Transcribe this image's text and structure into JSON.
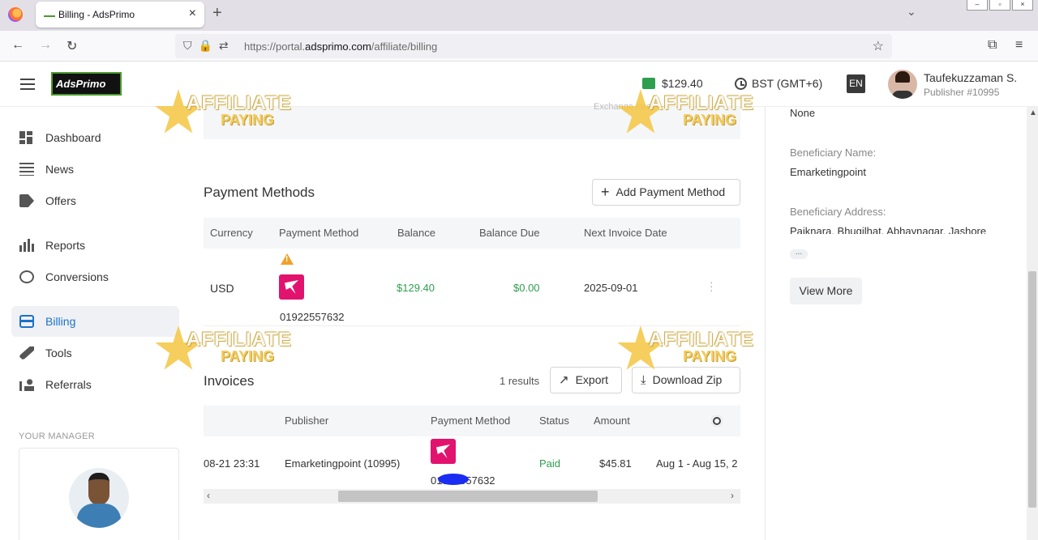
{
  "browser": {
    "tab_title": "Billing - AdsPrimo",
    "url_prefix": "https://portal.",
    "url_domain": "adsprimo.com",
    "url_path": "/affiliate/billing"
  },
  "header": {
    "logo_text": "AdsPrimo",
    "balance": "$129.40",
    "timezone": "BST (GMT+6)",
    "language": "EN",
    "user_name": "Taufekuzzaman S.",
    "user_sub": "Publisher #10995"
  },
  "sidebar": {
    "items": [
      {
        "label": "Dashboard"
      },
      {
        "label": "News"
      },
      {
        "label": "Offers"
      },
      {
        "label": "Reports"
      },
      {
        "label": "Conversions"
      },
      {
        "label": "Billing"
      },
      {
        "label": "Tools"
      },
      {
        "label": "Referrals"
      }
    ],
    "manager_label": "YOUR MANAGER"
  },
  "payment_methods": {
    "exchange_hint": "Exchange rate",
    "title": "Payment Methods",
    "add_button": "Add Payment Method",
    "columns": [
      "Currency",
      "Payment Method",
      "Balance",
      "Balance Due",
      "Next Invoice Date"
    ],
    "rows": [
      {
        "currency": "USD",
        "method_number": "01922557632",
        "balance": "$129.40",
        "balance_due": "$0.00",
        "next_invoice": "2025-09-01"
      }
    ]
  },
  "invoices": {
    "title": "Invoices",
    "results": "1  results",
    "export_button": "Export",
    "zip_button": "Download Zip",
    "columns": [
      "Publisher",
      "Payment Method",
      "Status",
      "Amount"
    ],
    "rows": [
      {
        "date": "08-21 23:31",
        "publisher": "Emarketingpoint (10995)",
        "method_number": "01922557632",
        "status": "Paid",
        "amount": "$45.81",
        "period": "Aug 1 - Aug 15, 2"
      }
    ]
  },
  "right_panel": {
    "top_value": "None",
    "beneficiary_name_label": "Beneficiary Name:",
    "beneficiary_name": "Emarketingpoint",
    "beneficiary_address_label": "Beneficiary Address:",
    "beneficiary_address": "Paiknara, Bhugilhat, Abhaynagar, Jashore",
    "ellipsis": "...",
    "view_more": "View More"
  },
  "watermark": {
    "line1": "AFFILIATE",
    "line2": "PAYING"
  },
  "colors": {
    "accent": "#1a73c8",
    "success": "#2e9e4f",
    "bkash": "#e2136e"
  }
}
